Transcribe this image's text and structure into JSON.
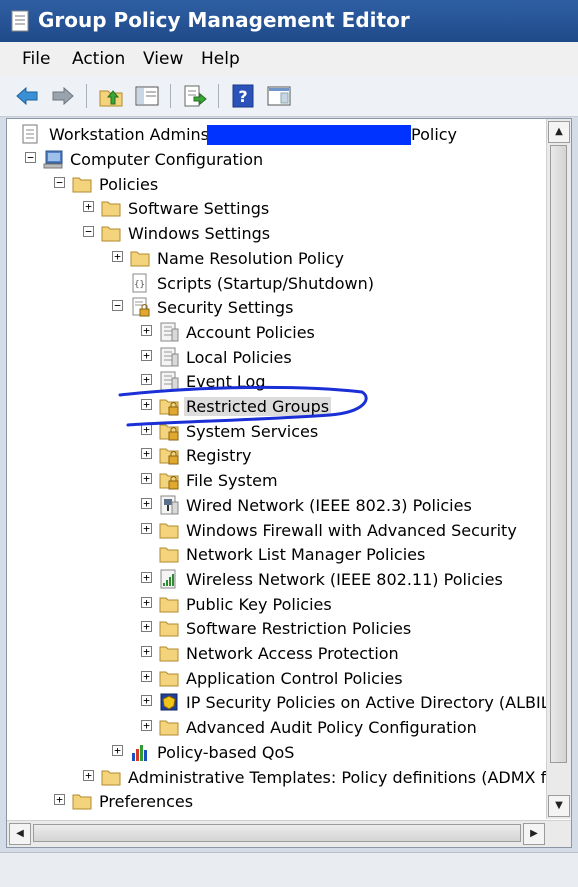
{
  "window": {
    "title": "Group Policy Management Editor"
  },
  "menu": [
    "File",
    "Action",
    "View",
    "Help"
  ],
  "toolbar": [
    "back-arrow-icon",
    "forward-arrow-icon",
    "up-folder-icon",
    "show-hide-tree-icon",
    "export-list-icon",
    "help-icon",
    "properties-pane-icon"
  ],
  "tree": {
    "root_prefix": "Workstation Admins",
    "root_suffix": "Policy",
    "nodes": [
      {
        "label": "Computer Configuration",
        "icon": "computer-icon",
        "expander": "minus"
      },
      {
        "label": "Policies",
        "icon": "folder-icon",
        "expander": "minus"
      },
      {
        "label": "Software Settings",
        "icon": "folder-icon",
        "expander": "plus"
      },
      {
        "label": "Windows Settings",
        "icon": "folder-icon",
        "expander": "minus"
      },
      {
        "label": "Name Resolution Policy",
        "icon": "folder-icon",
        "expander": "plus"
      },
      {
        "label": "Scripts (Startup/Shutdown)",
        "icon": "scripts-icon",
        "expander": "none"
      },
      {
        "label": "Security Settings",
        "icon": "security-settings-icon",
        "expander": "minus"
      },
      {
        "label": "Account Policies",
        "icon": "policy-doc-icon",
        "expander": "plus"
      },
      {
        "label": "Local Policies",
        "icon": "policy-doc-icon",
        "expander": "plus"
      },
      {
        "label": "Event Log",
        "icon": "policy-doc-icon",
        "expander": "plus"
      },
      {
        "label": "Restricted Groups",
        "icon": "locked-folder-icon",
        "expander": "plus",
        "selected": true
      },
      {
        "label": "System Services",
        "icon": "locked-folder-icon",
        "expander": "plus"
      },
      {
        "label": "Registry",
        "icon": "locked-folder-icon",
        "expander": "plus"
      },
      {
        "label": "File System",
        "icon": "locked-folder-icon",
        "expander": "plus"
      },
      {
        "label": "Wired Network (IEEE 802.3) Policies",
        "icon": "wired-network-icon",
        "expander": "plus"
      },
      {
        "label": "Windows Firewall with Advanced Security",
        "icon": "folder-icon",
        "expander": "plus"
      },
      {
        "label": "Network List Manager Policies",
        "icon": "folder-icon",
        "expander": "none"
      },
      {
        "label": "Wireless Network (IEEE 802.11) Policies",
        "icon": "wireless-network-icon",
        "expander": "plus"
      },
      {
        "label": "Public Key Policies",
        "icon": "folder-icon",
        "expander": "plus"
      },
      {
        "label": "Software Restriction Policies",
        "icon": "folder-icon",
        "expander": "plus"
      },
      {
        "label": "Network Access Protection",
        "icon": "folder-icon",
        "expander": "plus"
      },
      {
        "label": "Application Control Policies",
        "icon": "folder-icon",
        "expander": "plus"
      },
      {
        "label": "IP Security Policies on Active Directory (ALBIL.C",
        "icon": "ip-security-icon",
        "expander": "plus"
      },
      {
        "label": "Advanced Audit Policy Configuration",
        "icon": "folder-icon",
        "expander": "plus"
      },
      {
        "label": "Policy-based QoS",
        "icon": "qos-chart-icon",
        "expander": "plus"
      },
      {
        "label": "Administrative Templates: Policy definitions (ADMX files)",
        "icon": "folder-icon",
        "expander": "plus"
      },
      {
        "label": "Preferences",
        "icon": "folder-icon",
        "expander": "plus"
      }
    ]
  },
  "colors": {
    "title_bar": "#1f4a8a",
    "redaction": "#0033ff",
    "annotation": "#1a2fd6",
    "folder": "#f3d37b"
  }
}
